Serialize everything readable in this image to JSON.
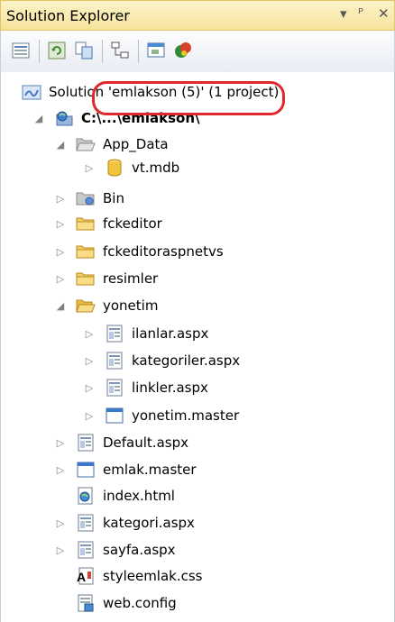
{
  "panel": {
    "title": "Solution Explorer",
    "controls": {
      "dropdown": "▾",
      "pin": "ᵠ",
      "close": "✕"
    }
  },
  "toolbar": {
    "buttons": [
      "properties",
      "refresh",
      "nest-related",
      "view-class-diagram",
      "view-designer",
      "copy-website"
    ]
  },
  "tree": {
    "solution": "Solution 'emlakson (5)' (1 project)",
    "project": "C:\\...\\emlakson\\",
    "items": [
      {
        "label": "App_Data",
        "icon": "folder-open"
      },
      {
        "label": "vt.mdb",
        "icon": "database"
      },
      {
        "label": "Bin",
        "icon": "folder-bin"
      },
      {
        "label": "fckeditor",
        "icon": "folder"
      },
      {
        "label": "fckeditoraspnetvs",
        "icon": "folder"
      },
      {
        "label": "resimler",
        "icon": "folder"
      },
      {
        "label": "yonetim",
        "icon": "folder-open"
      },
      {
        "label": "ilanlar.aspx",
        "icon": "aspx"
      },
      {
        "label": "kategoriler.aspx",
        "icon": "aspx"
      },
      {
        "label": "linkler.aspx",
        "icon": "aspx"
      },
      {
        "label": "yonetim.master",
        "icon": "master"
      },
      {
        "label": "Default.aspx",
        "icon": "aspx"
      },
      {
        "label": "emlak.master",
        "icon": "master"
      },
      {
        "label": "index.html",
        "icon": "html"
      },
      {
        "label": "kategori.aspx",
        "icon": "aspx"
      },
      {
        "label": "sayfa.aspx",
        "icon": "aspx"
      },
      {
        "label": "styleemlak.css",
        "icon": "css"
      },
      {
        "label": "web.config",
        "icon": "config"
      }
    ]
  },
  "annotation": {
    "highlighted_item": "vt.mdb",
    "color": "#e0282c"
  }
}
